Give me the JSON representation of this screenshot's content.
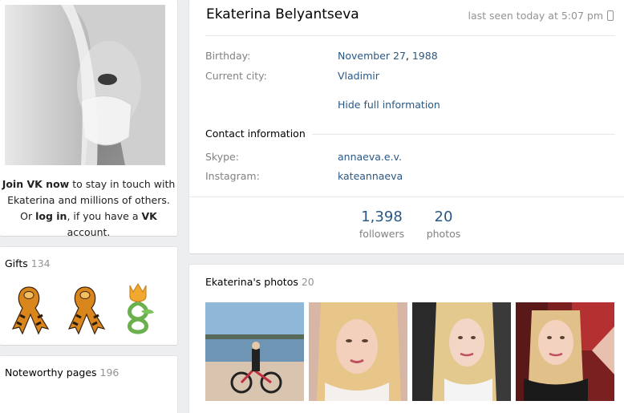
{
  "left": {
    "join_bold1": "Join VK now",
    "join_text1": " to stay in touch with",
    "join_line2": "Ekaterina and millions of others.",
    "join_or": "Or ",
    "join_login": "log in",
    "join_mid": ", if you have a ",
    "join_vk": "VK",
    "join_end": " account."
  },
  "gifts": {
    "title": "Gifts",
    "count": "134"
  },
  "noteworthy": {
    "title": "Noteworthy pages",
    "count": "196"
  },
  "profile": {
    "name": "Ekaterina Belyantseva",
    "last_seen": "last seen today at 5:07 pm",
    "birthday_label": "Birthday:",
    "birthday_value_a": "November 27",
    "birthday_value_b": ", ",
    "birthday_value_c": "1988",
    "city_label": "Current city:",
    "city_value": "Vladimir",
    "hide_info": "Hide full information",
    "contact_heading": "Contact information",
    "skype_label": "Skype:",
    "skype_value": "annaeva.e.v.",
    "instagram_label": "Instagram:",
    "instagram_value": "kateannaeva",
    "followers_num": "1,398",
    "followers_cap": "followers",
    "photos_num": "20",
    "photos_cap": "photos"
  },
  "photos": {
    "title": "Ekaterina's photos",
    "count": "20"
  },
  "colors": {
    "link": "#2a5885",
    "muted": "#828282",
    "background": "#edeef0"
  }
}
